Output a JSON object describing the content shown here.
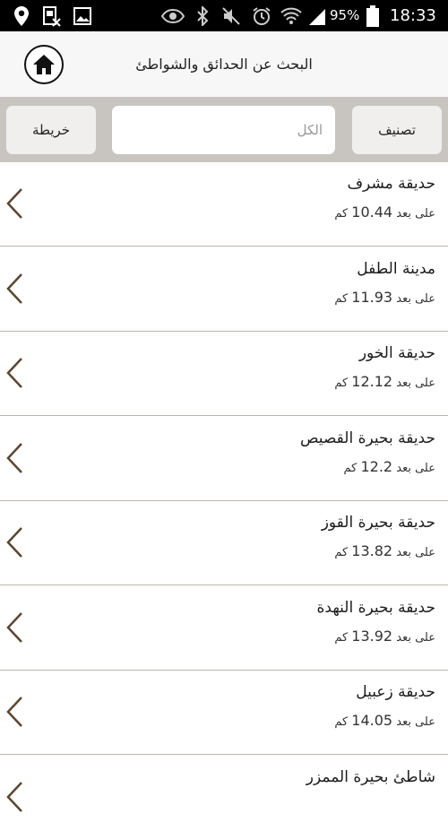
{
  "status_bar": {
    "battery": "95%",
    "time": "18:33",
    "icons": [
      "location-icon",
      "sim-icon",
      "image-icon",
      "eye-icon",
      "bluetooth-icon",
      "mute-icon",
      "alarm-icon",
      "wifi-icon",
      "signal-icon",
      "battery-icon"
    ]
  },
  "header": {
    "title": "البحث عن الحدائق والشواطئ",
    "home_icon": "home-icon"
  },
  "toolbar": {
    "map_label": "خريطة",
    "search_placeholder": "الكل",
    "category_label": "تصنيف"
  },
  "list": {
    "distance_prefix": "على بعد",
    "distance_unit": "كم",
    "items": [
      {
        "name": "حديقة مشرف",
        "distance": "10.44"
      },
      {
        "name": "مدينة الطفل",
        "distance": "11.93"
      },
      {
        "name": "حديقة الخور",
        "distance": "12.12"
      },
      {
        "name": "حديقة بحيرة القصيص",
        "distance": "12.2"
      },
      {
        "name": "حديقة بحيرة القوز",
        "distance": "13.82"
      },
      {
        "name": "حديقة  بحيرة النهدة",
        "distance": "13.92"
      },
      {
        "name": "حديقة زعبيل",
        "distance": "14.05"
      },
      {
        "name": "شاطئ بحيرة الممزر",
        "distance": ""
      }
    ]
  },
  "colors": {
    "status_bar_bg": "#000000",
    "header_bg": "#f7f7f7",
    "toolbar_bg": "#c8c5c0",
    "button_bg": "#f0efed",
    "divider": "#bdb7ae",
    "chevron": "#5a4630"
  }
}
